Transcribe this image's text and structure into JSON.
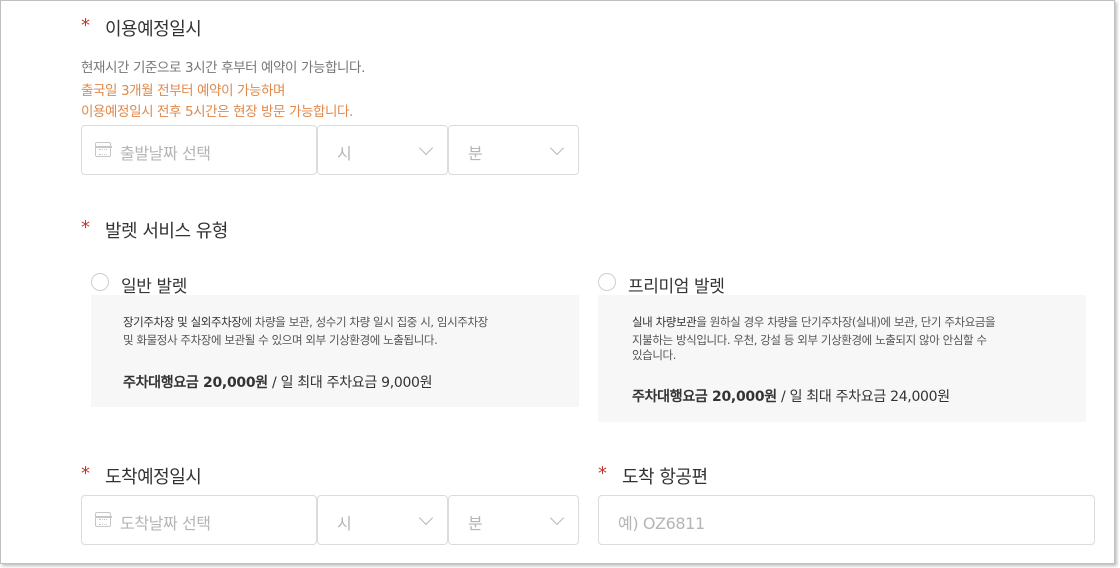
{
  "usage": {
    "marker": "*",
    "title": "이용예정일시",
    "desc": "현재시간 기준으로 3시간 후부터 예약이 가능합니다.",
    "notice_line1": "출국일 3개월 전부터 예약이 가능하며",
    "notice_line2": "이용예정일시 전후 5시간은 현장 방문 가능합니다.",
    "date_placeholder": "출발날짜 선택",
    "hour_value": "시",
    "minute_value": "분"
  },
  "valet": {
    "marker": "*",
    "title": "발렛 서비스 유형",
    "options": [
      {
        "label": "일반 발렛",
        "desc_bold1": "장기주차장 및 실외주차장",
        "desc_rest1": "에 차량을 보관, 성수기 차량 일시 집중 시, 임시주차장",
        "desc_line2": "및 화물정사 주차장에 보관될 수 있으며 외부 기상환경에 노출됩니다.",
        "fee_label": "주차대행요금 20,000원",
        "fee_sep": " / ",
        "fee_max": "일 최대 주차요금 9,000원"
      },
      {
        "label": "프리미엄 발렛",
        "desc_bold1": "실내 차량보관",
        "desc_rest1": "을 원하실 경우 차량을 단기주차장(실내)에 보관, 단기 주차요금을",
        "desc_line2": "지불하는 방식입니다. 우천, 강설 등 외부 기상환경에 노출되지 않아 안심할 수",
        "desc_line3": "있습니다.",
        "fee_label": "주차대행요금 20,000원",
        "fee_sep": " / ",
        "fee_max": "일 최대 주차요금 24,000원"
      }
    ]
  },
  "arrival": {
    "marker": "*",
    "title": "도착예정일시",
    "date_placeholder": "도착날짜 선택",
    "hour_value": "시",
    "minute_value": "분"
  },
  "flight": {
    "marker": "*",
    "title": "도착 항공편",
    "placeholder": "예) OZ6811"
  }
}
